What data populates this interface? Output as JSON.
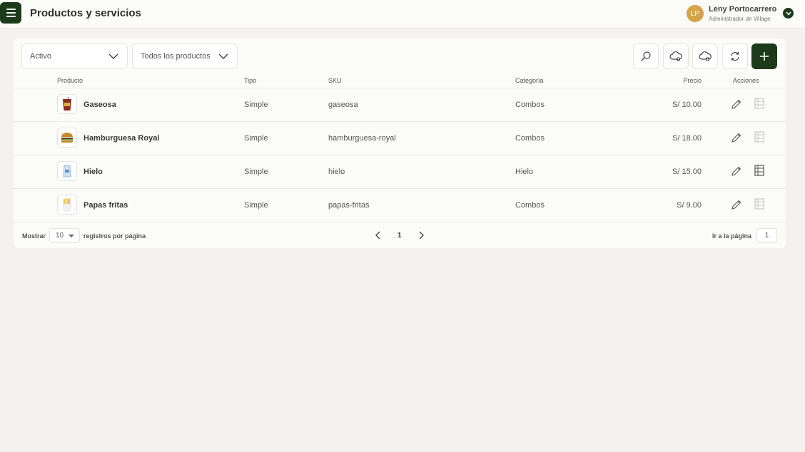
{
  "header": {
    "title": "Productos y servicios",
    "user": {
      "initials": "LP",
      "name": "Leny Portocarrero",
      "role": "Administrador de Village"
    }
  },
  "filters": {
    "status": "Activo",
    "product_type": "Todos los productos"
  },
  "toolbar_icons": [
    "search-icon",
    "cloud-upload-icon",
    "cloud-download-icon",
    "refresh-icon",
    "plus-icon"
  ],
  "columns": {
    "product": "Producto",
    "type": "Tipo",
    "sku": "SKU",
    "category": "Categoría",
    "price": "Precio",
    "actions": "Acciones"
  },
  "rows": [
    {
      "name": "Gaseosa",
      "type": "Simple",
      "sku": "gaseosa",
      "category": "Combos",
      "price": "S/ 10.00",
      "stock_active": false
    },
    {
      "name": "Hamburguesa Royal",
      "type": "Simple",
      "sku": "hamburguesa-royal",
      "category": "Combos",
      "price": "S/ 18.00",
      "stock_active": false
    },
    {
      "name": "Hielo",
      "type": "Simple",
      "sku": "hielo",
      "category": "Hielo",
      "price": "S/ 15.00",
      "stock_active": true
    },
    {
      "name": "Papas fritas",
      "type": "Simple",
      "sku": "papas-fritas",
      "category": "Combos",
      "price": "S/ 9.00",
      "stock_active": false
    }
  ],
  "pagination": {
    "show_label": "Mostrar",
    "page_size": "10",
    "per_page_label": "registros por página",
    "current_page": "1",
    "goto_label": "Ir a la página",
    "goto_value": "1"
  },
  "colors": {
    "brand": "#1d3a1a",
    "avatar": "#d6a24c",
    "background": "#f3f2ee"
  }
}
